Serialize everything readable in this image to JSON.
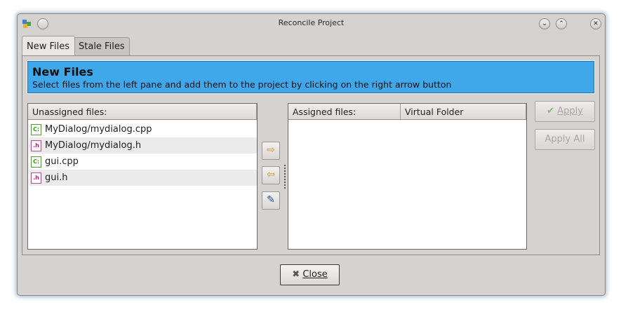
{
  "window": {
    "title": "Reconcile Project",
    "minimize_glyph": "⌄",
    "maximize_glyph": "⌃",
    "close_glyph": "✕"
  },
  "tabs": [
    {
      "label": "New Files",
      "active": true
    },
    {
      "label": "Stale Files",
      "active": false
    }
  ],
  "header": {
    "title": "New Files",
    "description": "Select files from the left pane and add them to the project by clicking on the right arrow button",
    "color": "#3fa7ea"
  },
  "unassigned": {
    "column": "Unassigned files:",
    "files": [
      {
        "name": "MyDialog/mydialog.cpp",
        "type": "cpp",
        "icon": "cpp-file-icon",
        "glyph": "C:"
      },
      {
        "name": "MyDialog/mydialog.h",
        "type": "h",
        "icon": "header-file-icon",
        "glyph": ".h"
      },
      {
        "name": "gui.cpp",
        "type": "cpp",
        "icon": "cpp-file-icon",
        "glyph": "C:"
      },
      {
        "name": "gui.h",
        "type": "h",
        "icon": "header-file-icon",
        "glyph": ".h"
      }
    ]
  },
  "assigned": {
    "columns": [
      "Assigned files:",
      "Virtual Folder"
    ],
    "files": []
  },
  "move_buttons": {
    "add_glyph": "⇨",
    "remove_glyph": "⇦",
    "wand_glyph": "✎"
  },
  "actions": {
    "apply": "Apply",
    "apply_check_glyph": "✔",
    "apply_all": "Apply All",
    "apply_enabled": false,
    "apply_all_enabled": false
  },
  "close_button": {
    "label": "Close",
    "glyph": "✖"
  }
}
